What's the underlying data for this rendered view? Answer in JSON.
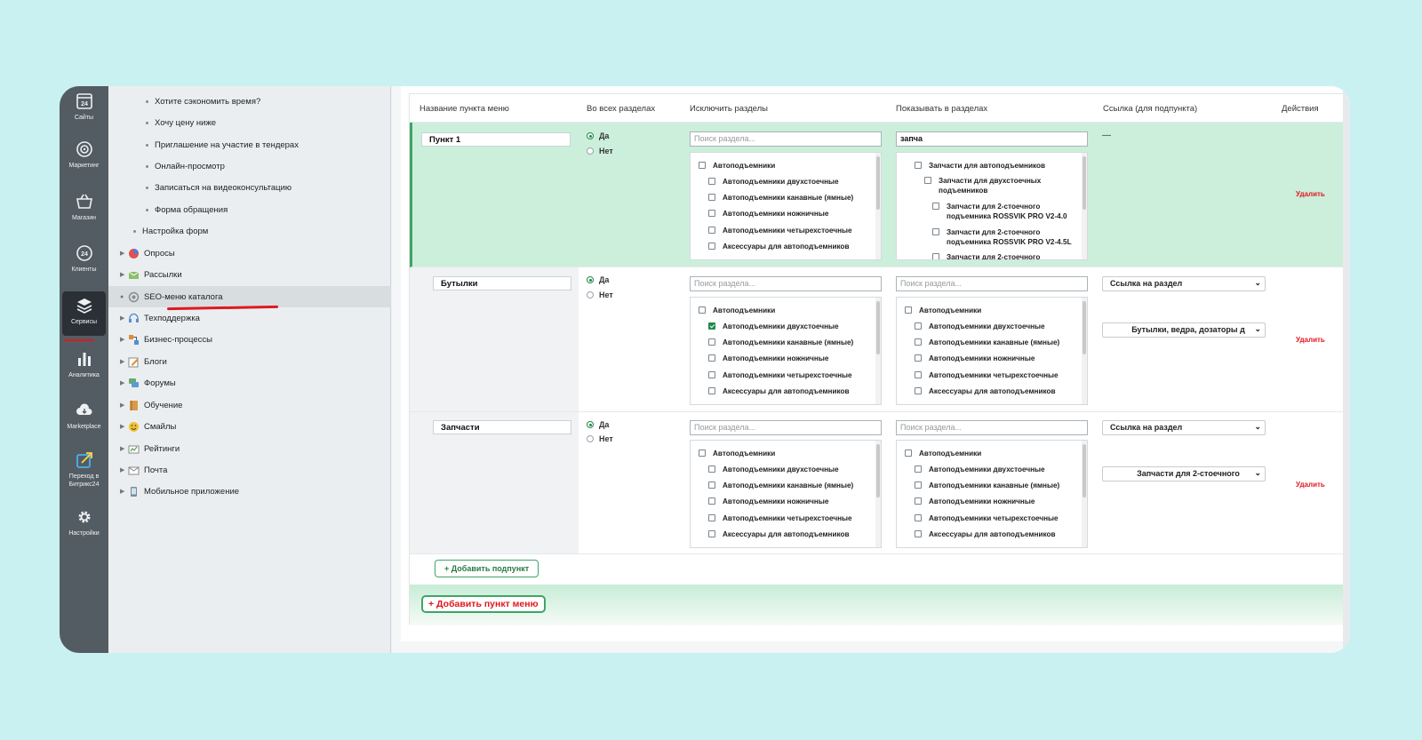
{
  "rail": {
    "items": [
      {
        "label": "Сайты",
        "icon": "calendar-24-icon"
      },
      {
        "label": "Маркетинг",
        "icon": "target-icon"
      },
      {
        "label": "Магазин",
        "icon": "basket-icon"
      },
      {
        "label": "Клиенты",
        "icon": "clients-24-icon"
      },
      {
        "label": "Сервисы",
        "icon": "layers-icon"
      },
      {
        "label": "Аналитика",
        "icon": "bar-chart-icon"
      },
      {
        "label": "Marketplace",
        "icon": "cloud-download-icon"
      },
      {
        "label": "Переход в Битрикс24",
        "icon": "external-link-icon"
      },
      {
        "label": "Настройки",
        "icon": "gear-icon"
      }
    ],
    "active_index": 4
  },
  "tree": {
    "sub_items": [
      "Хотите сэкономить время?",
      "Хочу цену ниже",
      "Приглашение на участие в тендерах",
      "Онлайн-просмотр",
      "Записаться на видеоконсультацию",
      "Форма обращения"
    ],
    "form_settings": "Настройка форм",
    "items": [
      {
        "label": "Опросы",
        "icon": "poll-icon"
      },
      {
        "label": "Рассылки",
        "icon": "mail-icon"
      },
      {
        "label": "SEO-меню каталога",
        "icon": "seo-icon",
        "selected": true
      },
      {
        "label": "Техподдержка",
        "icon": "headset-icon"
      },
      {
        "label": "Бизнес-процессы",
        "icon": "process-icon"
      },
      {
        "label": "Блоги",
        "icon": "blog-icon"
      },
      {
        "label": "Форумы",
        "icon": "forum-icon"
      },
      {
        "label": "Обучение",
        "icon": "book-icon"
      },
      {
        "label": "Смайлы",
        "icon": "smile-icon"
      },
      {
        "label": "Рейтинги",
        "icon": "rating-icon"
      },
      {
        "label": "Почта",
        "icon": "envelope-icon"
      },
      {
        "label": "Мобильное приложение",
        "icon": "mobile-icon"
      }
    ]
  },
  "table": {
    "headers": [
      "Название пункта меню",
      "Во всех разделах",
      "Исключить разделы",
      "Показывать в разделах",
      "Ссылка (для подпункта)",
      "Действия"
    ],
    "radio_yes": "Да",
    "radio_no": "Нет",
    "search_placeholder": "Поиск раздела...",
    "delete_label": "Удалить",
    "dash": "—",
    "exclude_list": [
      {
        "label": "Автоподъемники",
        "level": 0
      },
      {
        "label": "Автоподъемники двухстоечные",
        "level": 1
      },
      {
        "label": "Автоподъемники канавные (ямные)",
        "level": 1
      },
      {
        "label": "Автоподъемники ножничные",
        "level": 1
      },
      {
        "label": "Автоподъемники четырехстоечные",
        "level": 1
      },
      {
        "label": "Аксессуары для автоподъемников",
        "level": 1
      }
    ],
    "rows": [
      {
        "name": "Пункт 1",
        "all_sections": "yes",
        "show_search": "запча",
        "show_list": [
          {
            "label": "Запчасти для автоподъемников",
            "level": 0
          },
          {
            "label": "Запчасти для двухстоечных подъемников",
            "level": 1
          },
          {
            "label": "Запчасти для 2-стоечного подъемника ROSSVIK PRO V2-4.0",
            "level": 2
          },
          {
            "label": "Запчасти для 2-стоечного подъемника ROSSVIK PRO V2-4.5L",
            "level": 2
          },
          {
            "label": "Запчасти для 2-стоечного",
            "level": 2
          }
        ]
      },
      {
        "name": "Бутылки",
        "all_sections": "yes",
        "link_type": "Ссылка на раздел",
        "link_section": "Бутылки, ведра, дозаторы д",
        "excluded_checked": "Автоподъемники двухстоечные"
      },
      {
        "name": "Запчасти",
        "all_sections": "yes",
        "link_type": "Ссылка на раздел",
        "link_section": "Запчасти для 2-стоечного"
      }
    ],
    "add_sub_button": "+ Добавить подпункт",
    "add_main_button": "+ Добавить пункт меню"
  },
  "colors": {
    "accent_green": "#3fa466",
    "highlight_row": "#ccefdb",
    "delete_red": "#e0181e",
    "background": "#c9f1f2"
  }
}
